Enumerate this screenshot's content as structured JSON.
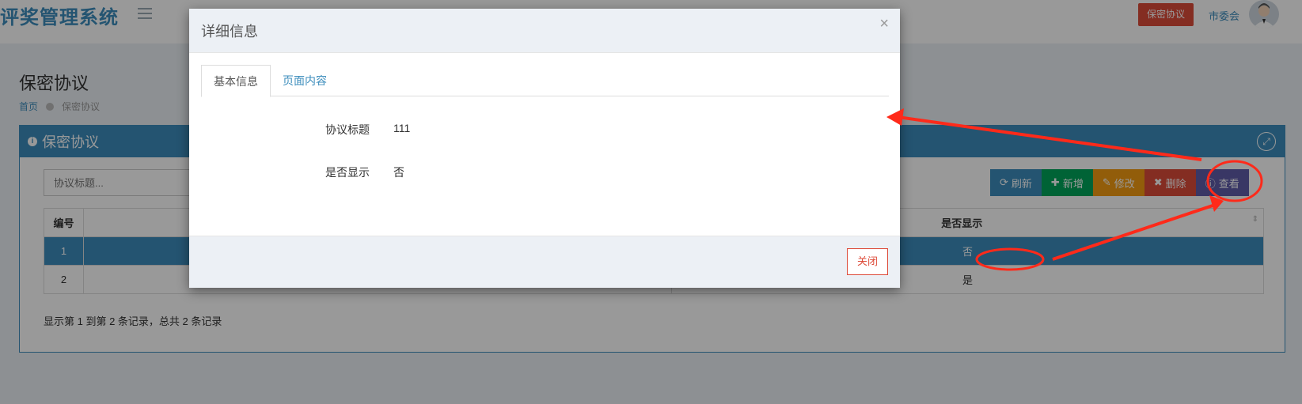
{
  "header": {
    "brand": "评奖管理系统",
    "badge": "保密协议",
    "user": "市委会"
  },
  "page": {
    "title": "保密协议",
    "breadcrumb_home": "首页",
    "breadcrumb_current": "保密协议"
  },
  "box": {
    "title": "保密协议",
    "search_placeholder": "协议标题...",
    "toolbar": {
      "refresh": "刷新",
      "add": "新增",
      "edit": "修改",
      "delete": "删除",
      "view": "查看"
    },
    "table": {
      "columns": [
        "编号",
        "",
        "是否显示"
      ],
      "rows": [
        {
          "id": "1",
          "title": "",
          "show": "否"
        },
        {
          "id": "2",
          "title": "",
          "show": "是"
        }
      ]
    },
    "summary": "显示第 1 到第 2 条记录，总共 2 条记录"
  },
  "modal": {
    "title": "详细信息",
    "close_symbol": "×",
    "tabs": [
      "基本信息",
      "页面内容"
    ],
    "fields": [
      {
        "label": "协议标题",
        "value": "111"
      },
      {
        "label": "是否显示",
        "value": "否"
      }
    ],
    "close_button": "关闭"
  },
  "colors": {
    "primary": "#3c8dbc",
    "danger": "#dd4b39",
    "annotation": "#ff2a1a"
  }
}
